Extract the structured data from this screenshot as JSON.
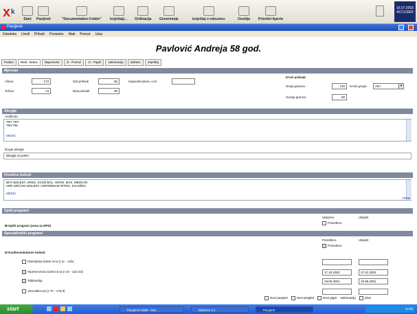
{
  "toolbar": {
    "buttons": [
      "Start",
      "Pacijenti",
      "\"Documentation Folder\"",
      "Izvještaji...",
      "Ordinacija",
      "Generiranje",
      "Izvještaj o odsustvu",
      "Osobije",
      "Prioritet Aperte"
    ],
    "clock": [
      "16.07.2003",
      "ACCUSER"
    ]
  },
  "window": {
    "title": "Pacijenti",
    "menu": [
      "Datoteka",
      "Uređi",
      "Prikaži",
      "Postavke",
      "Alati",
      "Pomoć",
      "Izlaz"
    ]
  },
  "patient": {
    "name": "Pavlović Andreja  58 god."
  },
  "tabs": [
    "Podaci",
    "Medi. Status",
    "Napomene",
    "O - Pomoć",
    "O - Papiri",
    "Vakcinacija",
    "Zahtevi",
    "Izvještaj"
  ],
  "sections": {
    "measurements": "Mjerenje",
    "allergies": "Alergije",
    "chronic": "Hronične bolesti",
    "general_program": "Opšti programi",
    "special_program": "Specijalistički programi"
  },
  "measurements": {
    "height_label": "Visina",
    "height_value": "173",
    "weight_label": "Težina",
    "weight_value": "73",
    "bp_sys_label": "Sist.pritisak",
    "bp_sys_value": "96",
    "bp_dia_label": "Dias.pritisak",
    "bp_dia_value": "96",
    "circ_label": "Kapacitet pluća, ccm",
    "circ_value": "",
    "blood_title": "Krvni pritisak",
    "lower_label": "Donja granica",
    "lower_value": "120",
    "group_label": "Krvna grupa",
    "group_value": "AB+",
    "upper_label": "Gornja granica",
    "upper_value": "80"
  },
  "allergies": {
    "header": "Antibiotici",
    "rows": [
      "TRT      TRT",
      "TIM      TIM"
    ],
    "more_link": "MEDIC",
    "other_label": "Druge alergije",
    "other_value": "alergija na polen"
  },
  "chronic": {
    "rows": [
      "BITA BOLEST, SRED. GVOŽ BOL. HRON. MAS. MEDICIN",
      "ARR SRČANA BOLEST, USPORENJE RITMA, ZALOŽNA"
    ],
    "more_link": "MEDIC",
    "more_link2": "PRIM"
  },
  "general_program": {
    "label": "Opšti program (cena za DPS)",
    "col1": "Uključen",
    "col2": "Uključit",
    "check_label": "Potvrđeno"
  },
  "special_program": {
    "group_label": "Kardiovaskularne bolesti",
    "col1": "Potvrđeno",
    "col2": "Uključit",
    "check_label": "Potvrđeno",
    "items": [
      {
        "label": "Ishemijska bolest srca (I 11 - 125)",
        "checked": false,
        "d1": "",
        "d2": ""
      },
      {
        "label": "Hipertenzivna bolest srca (I 10 - 115 I15)",
        "checked": true,
        "d1": "17.10.2002",
        "d2": "27.01.2003"
      },
      {
        "label": "Tahikardija",
        "checked": true,
        "d1": "19.06.2001",
        "d2": "19.06.2001"
      },
      {
        "label": "Ateroskleroza (I 70 - 179.9)",
        "checked": false,
        "d1": "",
        "d2": ""
      }
    ]
  },
  "footer_buttons": [
    "Novi pacijent",
    "Novi pregled",
    "Novi papir",
    "Vakcinacija",
    "Izlaz"
  ],
  "taskbar": {
    "start": "start",
    "tasks": [
      "Pacijenti Folder - Mic...",
      "Medicus 3.1",
      "Pacijenti"
    ],
    "tray_time": "10:00"
  }
}
